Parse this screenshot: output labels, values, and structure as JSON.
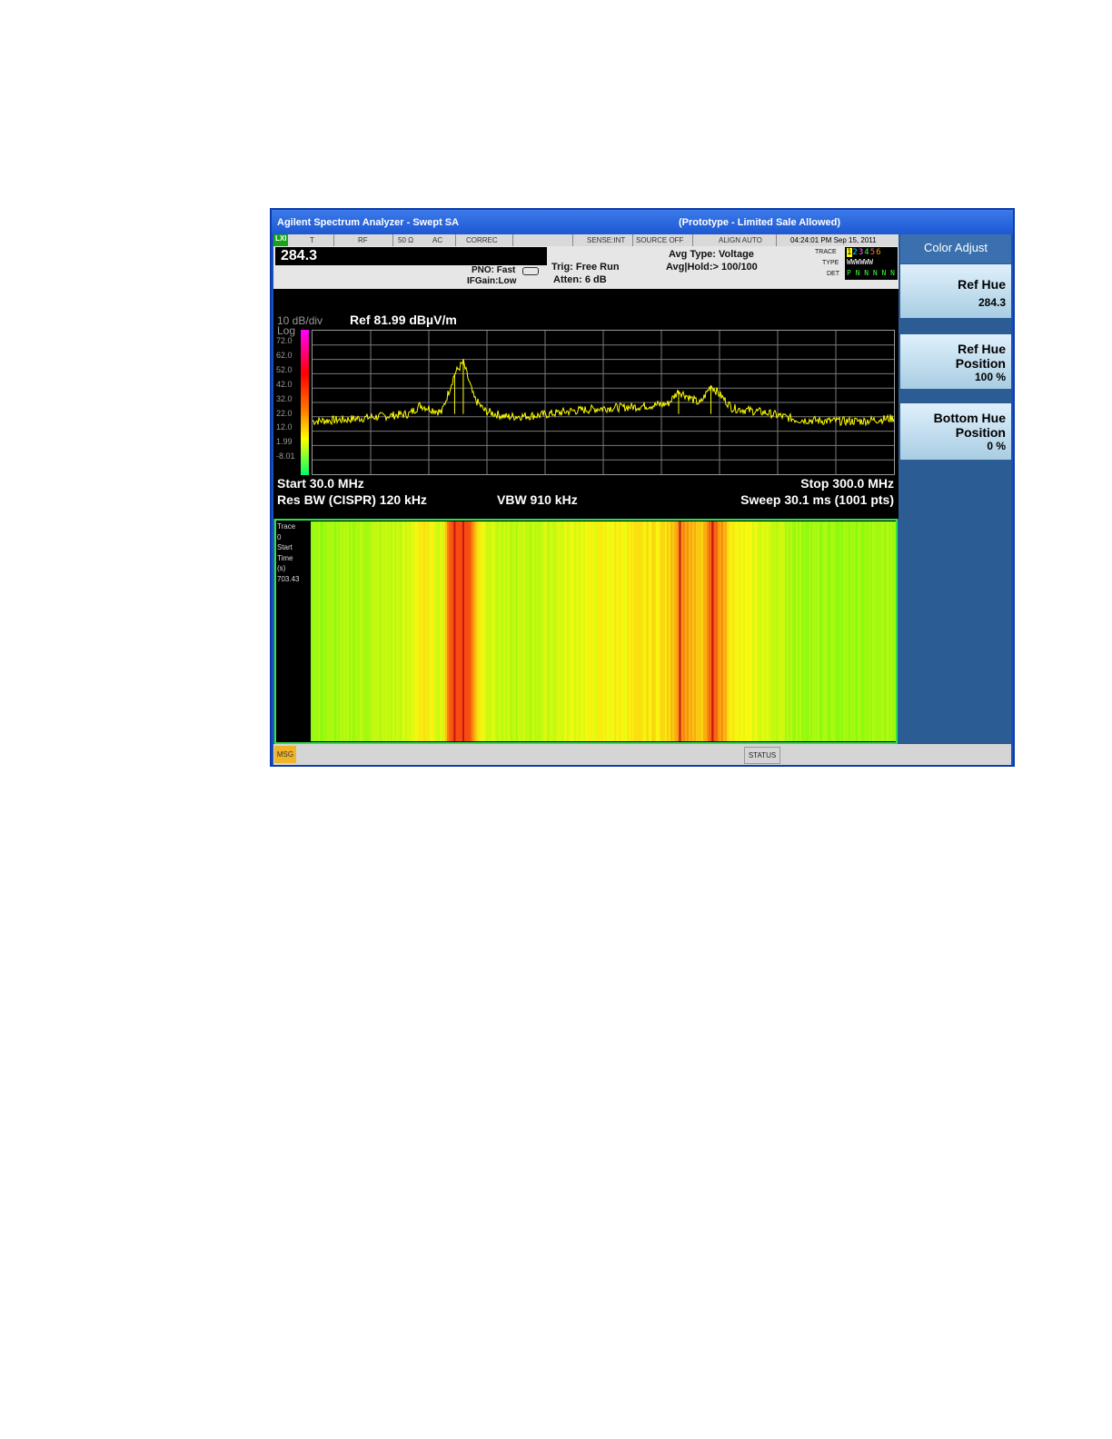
{
  "window": {
    "title": "Agilent Spectrum Analyzer - Swept SA",
    "subtitle": "(Prototype - Limited Sale Allowed)"
  },
  "status_bar": {
    "lxi": "LXI",
    "t": "T",
    "rf": "RF",
    "ohm": "50 Ω",
    "ac": "AC",
    "correc": "CORREC",
    "sense": "SENSE:INT",
    "source": "SOURCE OFF",
    "align": "ALIGN AUTO",
    "datetime": "04:24:01 PM Sep 15, 2011"
  },
  "active_value": "284.3",
  "settings": {
    "pno": "PNO: Fast",
    "ifgain": "IFGain:Low",
    "trig": "Trig: Free Run",
    "atten": "Atten: 6 dB",
    "avg_type": "Avg Type: Voltage",
    "avg_hold": "Avg|Hold:> 100/100"
  },
  "trace_panel": {
    "trace_label": "TRACE",
    "type_label": "TYPE",
    "det_label": "DET",
    "trace_numbers": [
      "1",
      "2",
      "3",
      "4",
      "5",
      "6"
    ],
    "type_values": "WWWWWW",
    "det_values": "P N N N N N"
  },
  "display": {
    "scale": "10 dB/div",
    "log": "Log",
    "ref": "Ref 81.99 dBµV/m",
    "start": "Start 30.0 MHz",
    "stop": "Stop 300.0 MHz",
    "res_bw": "Res BW (CISPR)  120 kHz",
    "vbw": "VBW 910 kHz",
    "sweep": "Sweep  30.1 ms (1001 pts)"
  },
  "chart_data": {
    "type": "line",
    "ylabel": "",
    "y_ticks": [
      "72.0",
      "62.0",
      "52.0",
      "42.0",
      "32.0",
      "22.0",
      "12.0",
      "1.99",
      "-8.01"
    ],
    "ylim": [
      -18.01,
      81.99
    ],
    "xlim": [
      30.0,
      300.0
    ],
    "x": [
      30,
      45,
      60,
      75,
      80,
      90,
      96,
      100,
      105,
      110,
      120,
      135,
      150,
      165,
      180,
      195,
      200,
      210,
      215,
      225,
      240,
      255,
      270,
      285,
      300
    ],
    "series": [
      {
        "values": [
          19,
          20,
          22,
          24,
          30,
          25,
          52,
          60,
          35,
          26,
          22,
          23,
          26,
          28,
          29,
          31,
          40,
          31,
          44,
          28,
          25,
          20,
          19,
          19,
          21
        ]
      }
    ],
    "grid": true
  },
  "waterfall": {
    "label_lines": [
      "Trace",
      "0",
      "Start",
      "Time",
      "(s)",
      "703.43"
    ]
  },
  "softkeys": {
    "title": "Color Adjust",
    "ref_hue": {
      "label": "Ref Hue",
      "value": "284.3"
    },
    "ref_hue_position": {
      "label1": "Ref Hue",
      "label2": "Position",
      "value": "100 %"
    },
    "bottom_hue_position": {
      "label1": "Bottom Hue",
      "label2": "Position",
      "value": "0 %"
    }
  },
  "message_bar": {
    "msg": "MSG",
    "status": "STATUS"
  },
  "colors": {
    "trace": "#ffff00",
    "grid": "#7a7a7a",
    "waterfall_border": "#2ee04b"
  }
}
